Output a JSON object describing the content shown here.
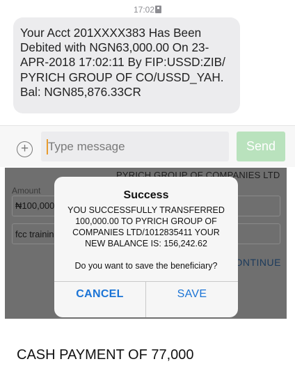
{
  "sms": {
    "timestamp": "17:02",
    "message": "Your Acct 201XXXX383 Has Been Debited with NGN63,000.00 On 23-APR-2018 17:02:11 By FIP:USSD:ZIB/ PYRICH GROUP OF CO/USSD_YAH. Bal: NGN85,876.33CR"
  },
  "composer": {
    "placeholder": "Type message",
    "send_label": "Send",
    "add_icon": "plus-circle-icon"
  },
  "bank_app": {
    "header": "PYRICH GROUP OF COMPANIES LTD",
    "amount_label": "Amount",
    "amount_value": "₦100,000",
    "narration_value": "fcc training",
    "continue_label": "CONTINUE"
  },
  "dialog": {
    "title": "Success",
    "message": "YOU SUCCESSFULLY TRANSFERRED 100,000.00 TO PYRICH GROUP OF COMPANIES LTD/1012835411 YOUR NEW BALANCE IS: 156,242.62",
    "question": "Do you want to save the beneficiary?",
    "cancel_label": "CANCEL",
    "save_label": "SAVE"
  },
  "caption": "CASH PAYMENT OF 77,000"
}
